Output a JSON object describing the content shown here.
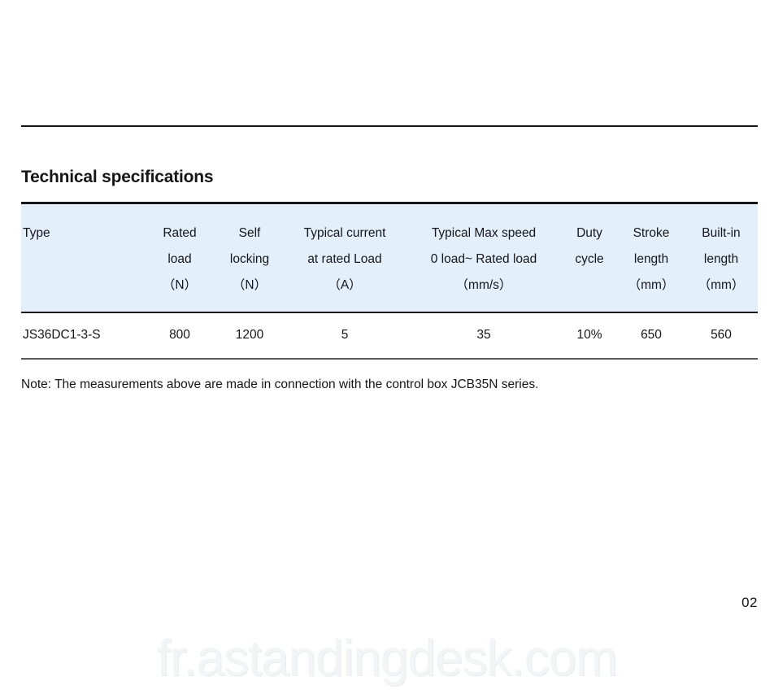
{
  "document": {
    "page_number": "02",
    "watermark": "fr.astandingdesk.com"
  },
  "section": {
    "heading": "Technical specifications",
    "note": "Note: The measurements above are made in connection with the control box JCB35N series."
  },
  "table": {
    "header_background": "#e3effa",
    "columns": [
      {
        "key": "type",
        "lines": [
          "Type",
          "",
          ""
        ]
      },
      {
        "key": "rated",
        "lines": [
          "Rated",
          "load",
          "（N）"
        ]
      },
      {
        "key": "self",
        "lines": [
          "Self",
          "locking",
          "（N）"
        ]
      },
      {
        "key": "current",
        "lines": [
          "Typical current",
          "at rated Load",
          "（A）"
        ]
      },
      {
        "key": "speed",
        "lines": [
          "Typical Max speed",
          "0 load~ Rated load",
          "（mm/s）"
        ]
      },
      {
        "key": "duty",
        "lines": [
          "Duty",
          "cycle",
          ""
        ]
      },
      {
        "key": "stroke",
        "lines": [
          "Stroke",
          "length",
          "（mm）"
        ]
      },
      {
        "key": "builtin",
        "lines": [
          "Built-in",
          "length",
          "（mm）"
        ]
      }
    ],
    "rows": [
      {
        "type": "JS36DC1-3-S",
        "rated": "800",
        "self": "1200",
        "current": "5",
        "speed": "35",
        "duty": "10%",
        "stroke": "650",
        "builtin": "560"
      }
    ]
  }
}
